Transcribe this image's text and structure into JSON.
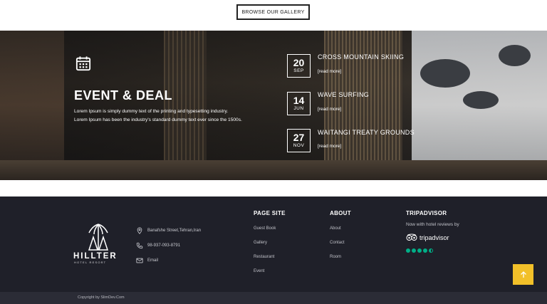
{
  "gallery_button": "BROWSE OUR GALLERY",
  "event": {
    "title": "EVENT & DEAL",
    "desc_line1": "Lorem Ipsum is simply dummy text of the printing and typesetting industry.",
    "desc_line2": "Lorem Ipsum has been the industry's standard dummy text ever since the 1500s.",
    "items": [
      {
        "day": "20",
        "month": "SEP",
        "name": "CROSS MOUNTAIN SKIING",
        "more": "[read more]"
      },
      {
        "day": "14",
        "month": "JUN",
        "name": "WAVE SURFING",
        "more": "[read more]"
      },
      {
        "day": "27",
        "month": "NOV",
        "name": "WAITANGI TREATY GROUNDS",
        "more": "[read more]"
      }
    ]
  },
  "footer": {
    "brand": "HILLTER",
    "brand_sub": "HOTEL RESORT",
    "contact": {
      "address": "Banafshe Street,Tehran,Iran",
      "phone": "98-937-093-8791",
      "email": "Email"
    },
    "page_site": {
      "title": "PAGE SITE",
      "links": [
        "Guest Book",
        "Gallery",
        "Restaurant",
        "Event"
      ]
    },
    "about": {
      "title": "ABOUT",
      "links": [
        "About",
        "Contact",
        "Room"
      ]
    },
    "tripadvisor": {
      "title": "TRIPADVISOR",
      "text": "Now with hotel reviews by",
      "logo_text": "tripadvisor",
      "rating": 4.5
    },
    "copyright": "Copyright by SlimDev.Com"
  },
  "colors": {
    "footer_bg": "#1f2029",
    "accent": "#f2c029",
    "tripadvisor_green": "#00af87"
  },
  "icons": [
    "calendar-icon",
    "location-icon",
    "phone-icon",
    "email-icon",
    "tripadvisor-owl-icon",
    "arrow-up-icon"
  ]
}
